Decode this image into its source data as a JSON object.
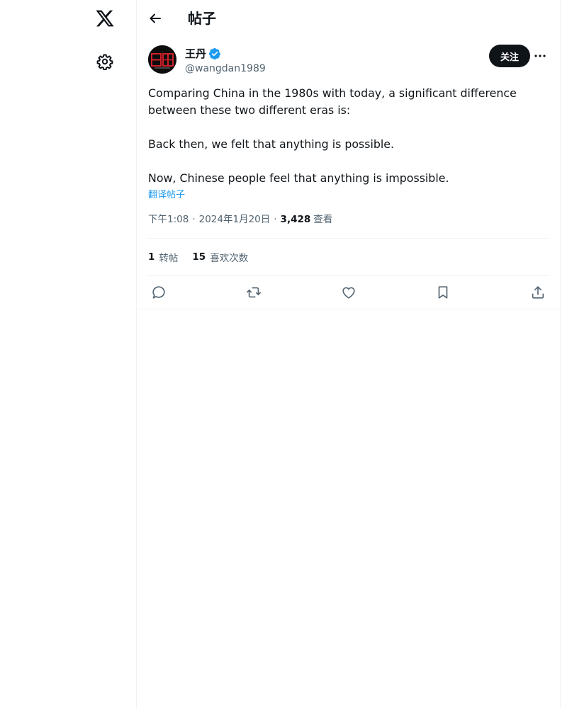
{
  "header": {
    "title": "帖子"
  },
  "nav": {
    "logo_icon": "x-logo-icon",
    "settings_icon": "gear-icon"
  },
  "tweet": {
    "author": {
      "name": "王丹",
      "handle": "@wangdan1989",
      "verified": true
    },
    "follow_label": "关注",
    "text": "Comparing China in the 1980s with today, a significant difference between these two different eras is:\n\nBack then, we felt that anything is possible.\n\nNow, Chinese people feel that anything is impossible.",
    "translate_label": "翻译帖子",
    "time": "下午1:08",
    "date": "2024年1月20日",
    "separator": "·",
    "views_count": "3,428",
    "views_label": "查看",
    "stats": {
      "reposts_count": "1",
      "reposts_label": "转帖",
      "likes_count": "15",
      "likes_label": "喜欢次数"
    },
    "actions": [
      "reply-icon",
      "repost-icon",
      "like-icon",
      "bookmark-icon",
      "share-icon"
    ]
  },
  "colors": {
    "text": "#0f1419",
    "secondary": "#536471",
    "accent": "#1d9bf0",
    "divider": "#eff3f4",
    "follow_bg": "#0f1419"
  }
}
